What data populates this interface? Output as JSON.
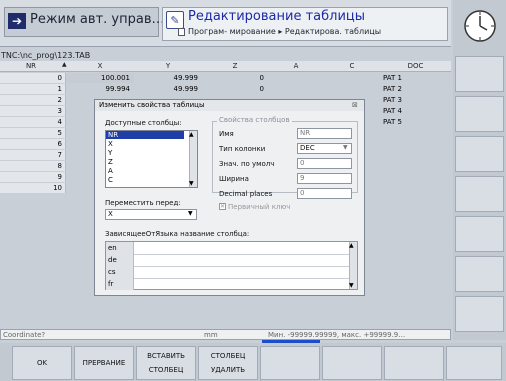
{
  "header": {
    "mode_label": "Режим авт. управ…",
    "edit_title": "Редактирование таблицы",
    "edit_subtitle": "Програм- мирование ▸ Редактирова. таблицы"
  },
  "path": "TNC:\\nc_prog\\123.TAB",
  "table": {
    "columns": [
      "NR",
      "X",
      "Y",
      "Z",
      "A",
      "C",
      "DOC"
    ],
    "rows": [
      {
        "nr": "0",
        "x": "100.001",
        "y": "49.999",
        "z": "0",
        "doc": "PAT 1"
      },
      {
        "nr": "1",
        "x": "99.994",
        "y": "49.999",
        "z": "0",
        "doc": "PAT 2"
      },
      {
        "nr": "2",
        "x": "",
        "y": "",
        "z": "",
        "doc": "PAT 3"
      },
      {
        "nr": "3",
        "x": "",
        "y": "",
        "z": "",
        "doc": "PAT 4"
      },
      {
        "nr": "4",
        "x": "",
        "y": "",
        "z": "",
        "doc": "PAT 5"
      },
      {
        "nr": "5",
        "x": "",
        "y": "",
        "z": "",
        "doc": ""
      },
      {
        "nr": "6",
        "x": "",
        "y": "",
        "z": "",
        "doc": ""
      },
      {
        "nr": "7",
        "x": "",
        "y": "",
        "z": "",
        "doc": ""
      },
      {
        "nr": "8",
        "x": "",
        "y": "",
        "z": "",
        "doc": ""
      },
      {
        "nr": "9",
        "x": "",
        "y": "",
        "z": "",
        "doc": ""
      },
      {
        "nr": "10",
        "x": "",
        "y": "",
        "z": "",
        "doc": ""
      }
    ]
  },
  "dialog": {
    "title": "Изменить свойства таблицы",
    "available_label": "Доступные столбцы:",
    "available_items": [
      "NR",
      "X",
      "Y",
      "Z",
      "A",
      "C"
    ],
    "selected_item": "NR",
    "move_before_label": "Переместить перед:",
    "move_before_value": "X",
    "props_title": "Свойства столбцов",
    "name_label": "Имя",
    "name_value": "NR",
    "type_label": "Тип колонки",
    "type_value": "DEC",
    "default_label": "Знач. по умолч",
    "default_value": "0",
    "width_label": "Ширина",
    "width_value": "9",
    "decimal_label": "Decimal places",
    "decimal_value": "0",
    "primary_key_label": "Первичный ключ",
    "lang_label": "ЗависящееОтЯзыка название столбца:",
    "languages": [
      "en",
      "de",
      "cs",
      "fr"
    ]
  },
  "status": {
    "prompt": "Coordinate?",
    "unit": "mm",
    "range": "Мин. -99999.99999, макс. +99999.9…"
  },
  "softkeys": {
    "ok": "OK",
    "abort": "ПРЕРВАНИЕ",
    "insert_line1": "ВСТАВИТЬ",
    "insert_line2": "СТОЛБЕЦ",
    "delete_line1": "СТОЛБЕЦ",
    "delete_line2": "УДАЛИТЬ"
  }
}
